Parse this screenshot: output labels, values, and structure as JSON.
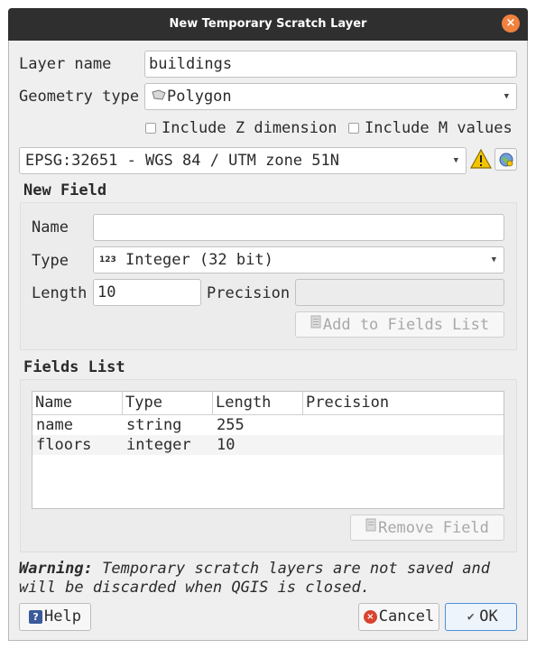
{
  "window": {
    "title": "New Temporary Scratch Layer",
    "close_glyph": "×"
  },
  "layer_name": {
    "label": "Layer name",
    "value": "buildings"
  },
  "geometry_type": {
    "label": "Geometry type",
    "value": "Polygon",
    "icon": "polygon-icon"
  },
  "include_z": {
    "label": "Include Z dimension",
    "checked": false
  },
  "include_m": {
    "label": "Include M values",
    "checked": false
  },
  "crs": {
    "value": "EPSG:32651 - WGS 84 / UTM zone 51N"
  },
  "new_field": {
    "title": "New Field",
    "name_label": "Name",
    "name_value": "",
    "type_label": "Type",
    "type_icon_text": "123",
    "type_value": "Integer (32 bit)",
    "length_label": "Length",
    "length_value": "10",
    "precision_label": "Precision",
    "precision_value": "",
    "add_button": "Add to Fields List"
  },
  "fields_list": {
    "title": "Fields List",
    "columns": [
      "Name",
      "Type",
      "Length",
      "Precision"
    ],
    "rows": [
      [
        "name",
        "string",
        "255",
        ""
      ],
      [
        "floors",
        "integer",
        "10",
        ""
      ]
    ],
    "remove_button": "Remove Field"
  },
  "warning": {
    "bold": "Warning:",
    "text": " Temporary scratch layers are not saved and",
    "text2": "will be discarded when QGIS is closed."
  },
  "buttons": {
    "help": "Help",
    "cancel": "Cancel",
    "ok": "OK"
  },
  "colors": {
    "titlebar": "#2f2f2f",
    "close": "#f0813e",
    "accent": "#4a90d9",
    "warning": "#f5c400"
  }
}
